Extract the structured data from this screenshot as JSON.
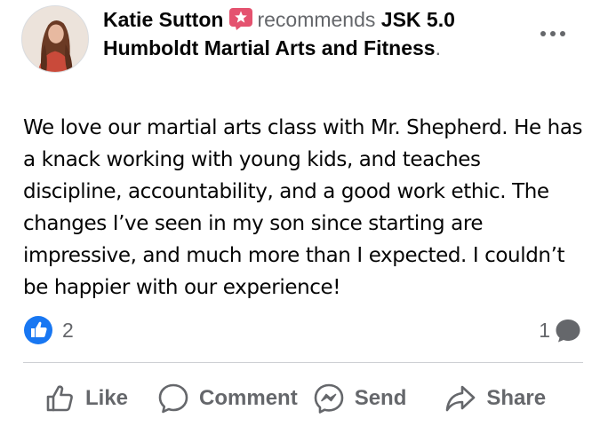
{
  "post": {
    "author_name": "Katie Sutton",
    "recommends_text": "recommends",
    "page_name": "JSK 5.0 Humboldt Martial Arts and Fitness",
    "period": ".",
    "body": "We love our martial arts class with Mr. Shepherd. He has a knack working with young kids, and teaches discipline, accountability, and a good work ethic. The changes I’ve seen in my son since starting are impressive, and much more than I expected. I couldn’t be happier with our experience!",
    "reactions_count": "2",
    "comments_count": "1"
  },
  "actions": {
    "like_label": "Like",
    "comment_label": "Comment",
    "send_label": "Send",
    "share_label": "Share"
  },
  "icons": {
    "recommend": "recommend-star-icon",
    "more": "more-options-icon",
    "like_badge": "like-reaction-icon",
    "comment_bubble": "comment-bubble-icon",
    "like": "thumbs-up-icon",
    "comment": "comment-icon",
    "send": "messenger-send-icon",
    "share": "share-arrow-icon"
  },
  "colors": {
    "text_primary": "#050505",
    "text_secondary": "#65676b",
    "like_blue": "#1877f2",
    "recommend_pink": "#e4526f",
    "divider": "#ced0d4"
  }
}
